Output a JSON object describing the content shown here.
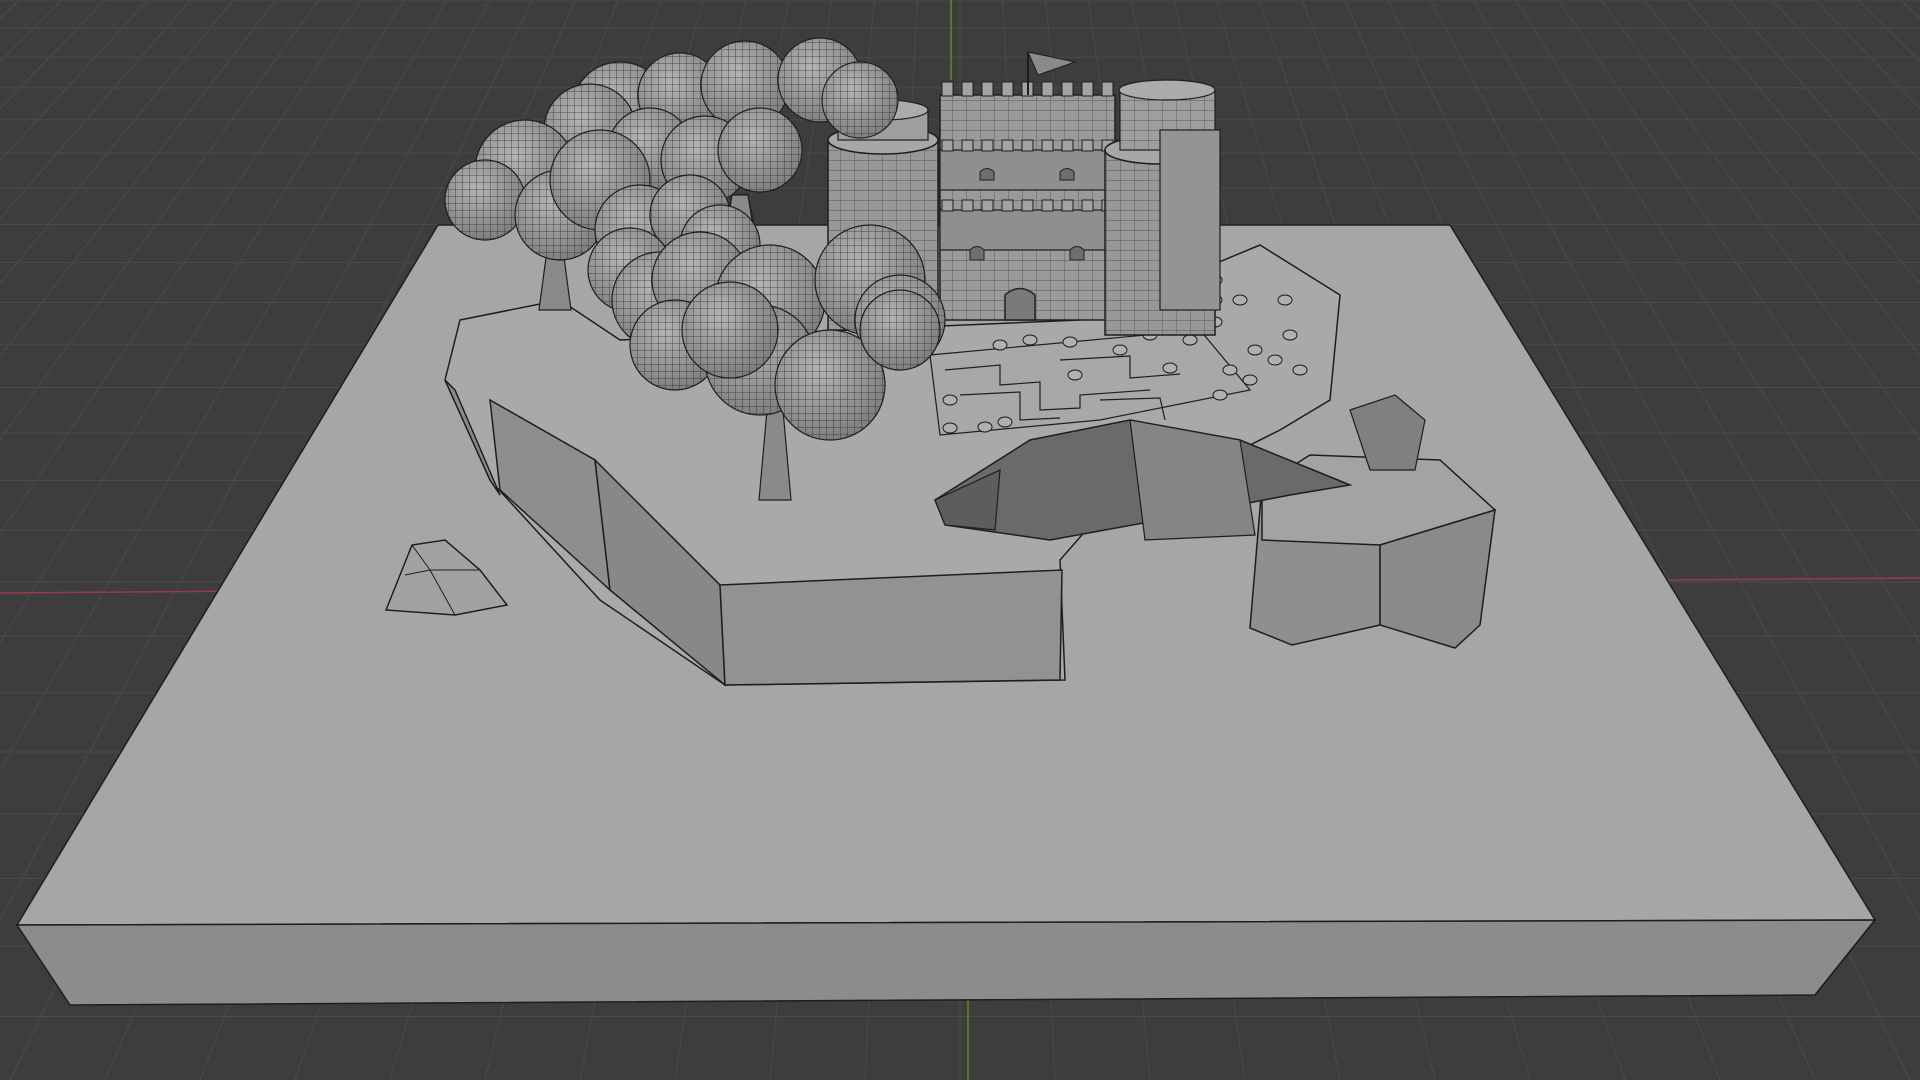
{
  "viewport": {
    "mode": "3d-viewport",
    "shading": "solid-wireframe-overlay"
  },
  "colors": {
    "background": "#3d3d3d",
    "grid_line": "#4a4a4a",
    "grid_line_major": "#555555",
    "axis_x": "#9a3a46",
    "axis_y": "#5f8a2a",
    "model_top": "#a5a5a5",
    "model_front": "#8f8f8f",
    "model_side": "#7a7a7a",
    "wire": "#1e1e1e",
    "dark_face": "#6a6a6a"
  },
  "scene": {
    "objects": [
      "base-slab",
      "terrain-cliff",
      "castle-keep",
      "tower-left",
      "tower-right",
      "tree-cluster-back",
      "tree-cluster-front",
      "boulder",
      "pit",
      "rock-pillar",
      "flag",
      "courtyard-path"
    ]
  }
}
